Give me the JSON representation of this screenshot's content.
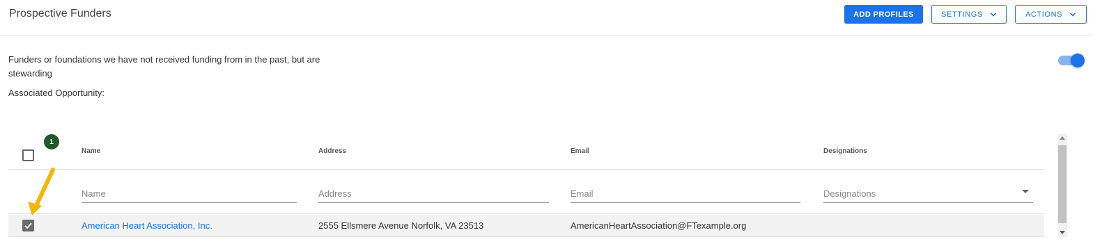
{
  "header": {
    "title": "Prospective Funders",
    "add_profiles_label": "ADD PROFILES",
    "settings_label": "SETTINGS",
    "actions_label": "ACTIONS"
  },
  "description": "Funders or foundations we have not received funding from in the past, but are stewarding",
  "associated_opportunity_label": "Associated Opportunity:",
  "toggle": {
    "on": true,
    "color": "#1a73e8"
  },
  "selection_badge": "1",
  "grid": {
    "columns": [
      "Name",
      "Address",
      "Email",
      "Designations"
    ],
    "filters": {
      "name_placeholder": "Name",
      "address_placeholder": "Address",
      "email_placeholder": "Email",
      "designations_placeholder": "Designations"
    },
    "rows": [
      {
        "checked": true,
        "name": "American Heart Association, Inc.",
        "address": "2555 Ellsmere Avenue Norfolk, VA 23513",
        "email": "AmericanHeartAssociation@FTexample.org",
        "designations": ""
      }
    ]
  },
  "colors": {
    "accent": "#1a73e8",
    "badge": "#1e5a2a",
    "arrow": "#f2b705"
  }
}
